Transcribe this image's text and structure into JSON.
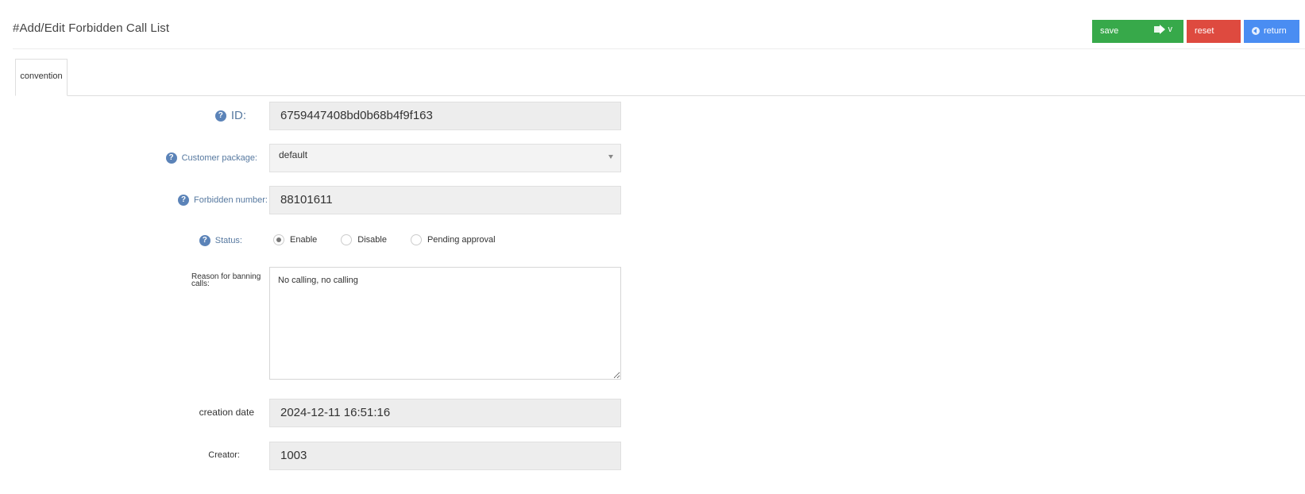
{
  "page": {
    "title": "#Add/Edit Forbidden Call List"
  },
  "toolbar": {
    "save_label": "save",
    "save_ext_label": "v",
    "reset_label": "reset",
    "return_label": "return",
    "colors": {
      "save": "#37a94a",
      "reset": "#de4a3f",
      "return": "#4a8df2"
    }
  },
  "tabs": [
    {
      "label": "convention",
      "active": true
    }
  ],
  "form": {
    "id": {
      "label": "ID:",
      "value": "6759447408bd0b68b4f9f163"
    },
    "customer_package": {
      "label": "Customer package:",
      "value": "default"
    },
    "forbidden_number": {
      "label": "Forbidden number:",
      "value": "88101611"
    },
    "status": {
      "label": "Status:",
      "options": [
        "Enable",
        "Disable",
        "Pending approval"
      ],
      "selected": "Enable"
    },
    "reason": {
      "label": "Reason for banning calls:",
      "value": "No calling, no calling"
    },
    "creation_date": {
      "label": "creation date",
      "value": "2024-12-11 16:51:16"
    },
    "creator": {
      "label": "Creator:",
      "value": "1003"
    }
  }
}
